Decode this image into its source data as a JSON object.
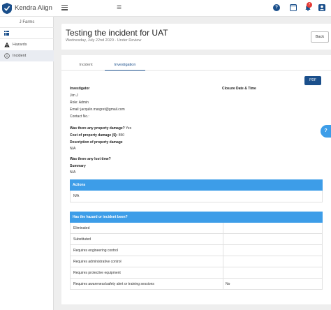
{
  "app": {
    "name": "Kendra Align",
    "org": "J Farms"
  },
  "sidebar": {
    "items": [
      {
        "label": "Hazards",
        "icon": "warning-icon"
      },
      {
        "label": "Incident",
        "icon": "info-circle-icon"
      }
    ]
  },
  "topbar": {
    "notification_count": "7",
    "help_label": "?"
  },
  "header": {
    "title": "Testing the incident for UAT",
    "subtitle": "Wednesday, July 22nd 2020 - Under Review",
    "back_label": "Back"
  },
  "tabs": [
    "Incident",
    "Investigation"
  ],
  "pdf_label": "PDF",
  "investigator": {
    "heading": "Investigator",
    "name": "Jim J",
    "role": "Role: Admin",
    "email": "Email: jacqulin.margret@gmail.com",
    "contact": "Contact No.:"
  },
  "closure": {
    "heading": "Closure Date & Time"
  },
  "property": {
    "damage_q": "Was there any property damage?",
    "damage_a": "Yes",
    "cost_q": "Cost of property damage ($):",
    "cost_a": "850",
    "desc_heading": "Description of property damage",
    "desc_value": "N/A"
  },
  "lost_time": {
    "q": "Was there any lost time?"
  },
  "summary": {
    "heading": "Summary",
    "value": "N/A"
  },
  "actions": {
    "heading": "Actions",
    "value": "N/A"
  },
  "hazard_table": {
    "heading": "Has the hazard or incident been?",
    "rows": [
      {
        "label": "Eliminated",
        "value": ""
      },
      {
        "label": "Substituted",
        "value": ""
      },
      {
        "label": "Requires engineering control",
        "value": ""
      },
      {
        "label": "Requires administrative control",
        "value": ""
      },
      {
        "label": "Requires protective equipment",
        "value": ""
      },
      {
        "label": "Requires awareness/safety alert or training sessions",
        "value": "No"
      }
    ]
  },
  "float_help": "?",
  "colors": {
    "primary": "#1a4f8b",
    "accent": "#3d9de8",
    "badge": "#e53935"
  }
}
